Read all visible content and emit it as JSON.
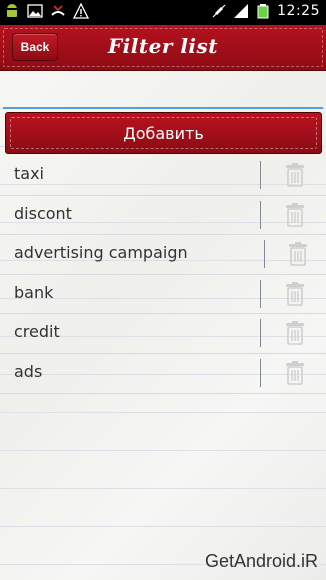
{
  "status_bar": {
    "time": "12:25",
    "left_icons": [
      "android-icon",
      "image-icon",
      "missed-call-icon",
      "warning-icon"
    ],
    "right_icons": [
      "mute-icon",
      "signal-icon",
      "battery-icon"
    ]
  },
  "header": {
    "back_label": "Back",
    "title": "Filter list"
  },
  "form": {
    "input_value": "",
    "add_label": "Добавить"
  },
  "items": [
    {
      "label": "taxi"
    },
    {
      "label": "discont"
    },
    {
      "label": "advertising campaign"
    },
    {
      "label": "bank"
    },
    {
      "label": "credit"
    },
    {
      "label": "ads"
    }
  ],
  "watermark": "GetAndroid.iR",
  "colors": {
    "header_red": "#a50f1a",
    "input_underline": "#4fa3d9"
  }
}
